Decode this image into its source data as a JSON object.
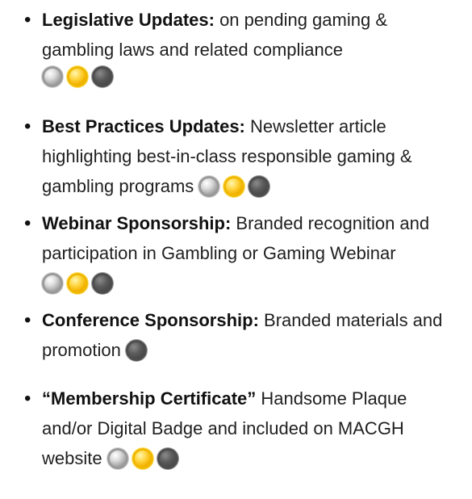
{
  "benefits": [
    {
      "title": "Legislative Updates:",
      "text": " on pending gaming & gambling laws and related compliance",
      "badges": [
        "silver-medal-icon",
        "gold-medal-icon",
        "platinum-medal-icon"
      ]
    },
    {
      "title": "Best Practices Updates:",
      "text": " Newsletter article highlighting best-in-class responsible gaming & gambling programs",
      "badges": [
        "silver-medal-icon",
        "gold-medal-icon",
        "platinum-medal-icon"
      ]
    },
    {
      "title": "Webinar Sponsorship:",
      "text": " Branded recognition and participation in Gambling or Gaming Webinar",
      "badges": [
        "silver-medal-icon",
        "gold-medal-icon",
        "platinum-medal-icon"
      ]
    },
    {
      "title": "Conference Sponsorship:",
      "text": " Branded materials and promotion",
      "badges": [
        "platinum-medal-icon"
      ]
    },
    {
      "title": "“Membership Certificate”",
      "text": " Handsome Plaque and/or Digital Badge and included on MACGH website",
      "badges": [
        "silver-medal-icon",
        "gold-medal-icon",
        "platinum-medal-icon"
      ]
    }
  ],
  "colors": {
    "text": "#1f1f1f",
    "silver": "#a6a6a6",
    "gold": "#f4b400",
    "platinum": "#4d4d4d"
  }
}
